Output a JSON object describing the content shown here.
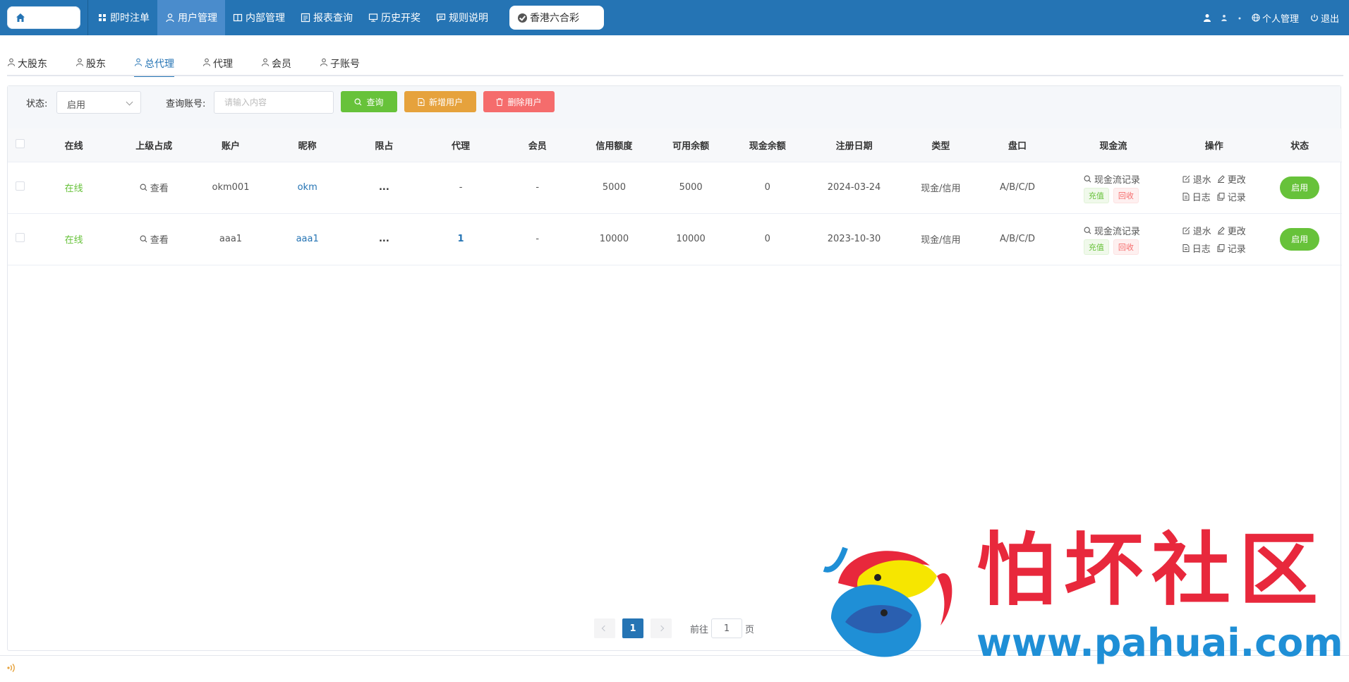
{
  "topbar": {
    "nav": [
      {
        "label": "即时注单",
        "icon": "grid-icon",
        "active": false
      },
      {
        "label": "用户管理",
        "icon": "user-icon",
        "active": true
      },
      {
        "label": "内部管理",
        "icon": "columns-icon",
        "active": false
      },
      {
        "label": "报表查询",
        "icon": "report-icon",
        "active": false
      },
      {
        "label": "历史开奖",
        "icon": "monitor-icon",
        "active": false
      },
      {
        "label": "规则说明",
        "icon": "chat-icon",
        "active": false
      }
    ],
    "game": "香港六合彩",
    "personal": "个人管理",
    "logout": "退出",
    "accent": "#2574b4"
  },
  "subtabs": [
    {
      "label": "大股东",
      "active": false
    },
    {
      "label": "股东",
      "active": false
    },
    {
      "label": "总代理",
      "active": true
    },
    {
      "label": "代理",
      "active": false
    },
    {
      "label": "会员",
      "active": false
    },
    {
      "label": "子账号",
      "active": false
    }
  ],
  "filter": {
    "status_label": "状态:",
    "status_value": "启用",
    "account_label": "查询账号:",
    "account_placeholder": "请输入内容",
    "query_btn": "查询",
    "add_btn": "新增用户",
    "delete_btn": "删除用户"
  },
  "table": {
    "headers": [
      "在线",
      "上级占成",
      "账户",
      "昵称",
      "限占",
      "代理",
      "会员",
      "信用额度",
      "可用余额",
      "现金余额",
      "注册日期",
      "类型",
      "盘口",
      "现金流",
      "操作",
      "状态"
    ],
    "rows": [
      {
        "online": "在线",
        "view": "查看",
        "account": "okm001",
        "nickname": "okm",
        "limit": "...",
        "agent": "-",
        "member": "-",
        "credit": "5000",
        "available": "5000",
        "cash": "0",
        "date": "2024-03-24",
        "type": "现金/信用",
        "handicap": "A/B/C/D",
        "cash_record": "现金流记录",
        "recharge": "充值",
        "recover": "回收",
        "op_rebate": "退水",
        "op_edit": "更改",
        "op_log": "日志",
        "op_record": "记录",
        "status": "启用"
      },
      {
        "online": "在线",
        "view": "查看",
        "account": "aaa1",
        "nickname": "aaa1",
        "limit": "...",
        "agent": "1",
        "member": "-",
        "credit": "10000",
        "available": "10000",
        "cash": "0",
        "date": "2023-10-30",
        "type": "现金/信用",
        "handicap": "A/B/C/D",
        "cash_record": "现金流记录",
        "recharge": "充值",
        "recover": "回收",
        "op_rebate": "退水",
        "op_edit": "更改",
        "op_log": "日志",
        "op_record": "记录",
        "status": "启用"
      }
    ]
  },
  "pagination": {
    "current": "1",
    "goto_label": "前往",
    "goto_value": "1",
    "unit": "页"
  },
  "watermark": {
    "title": "怕坏社区",
    "url": "www.pahuai.com"
  }
}
